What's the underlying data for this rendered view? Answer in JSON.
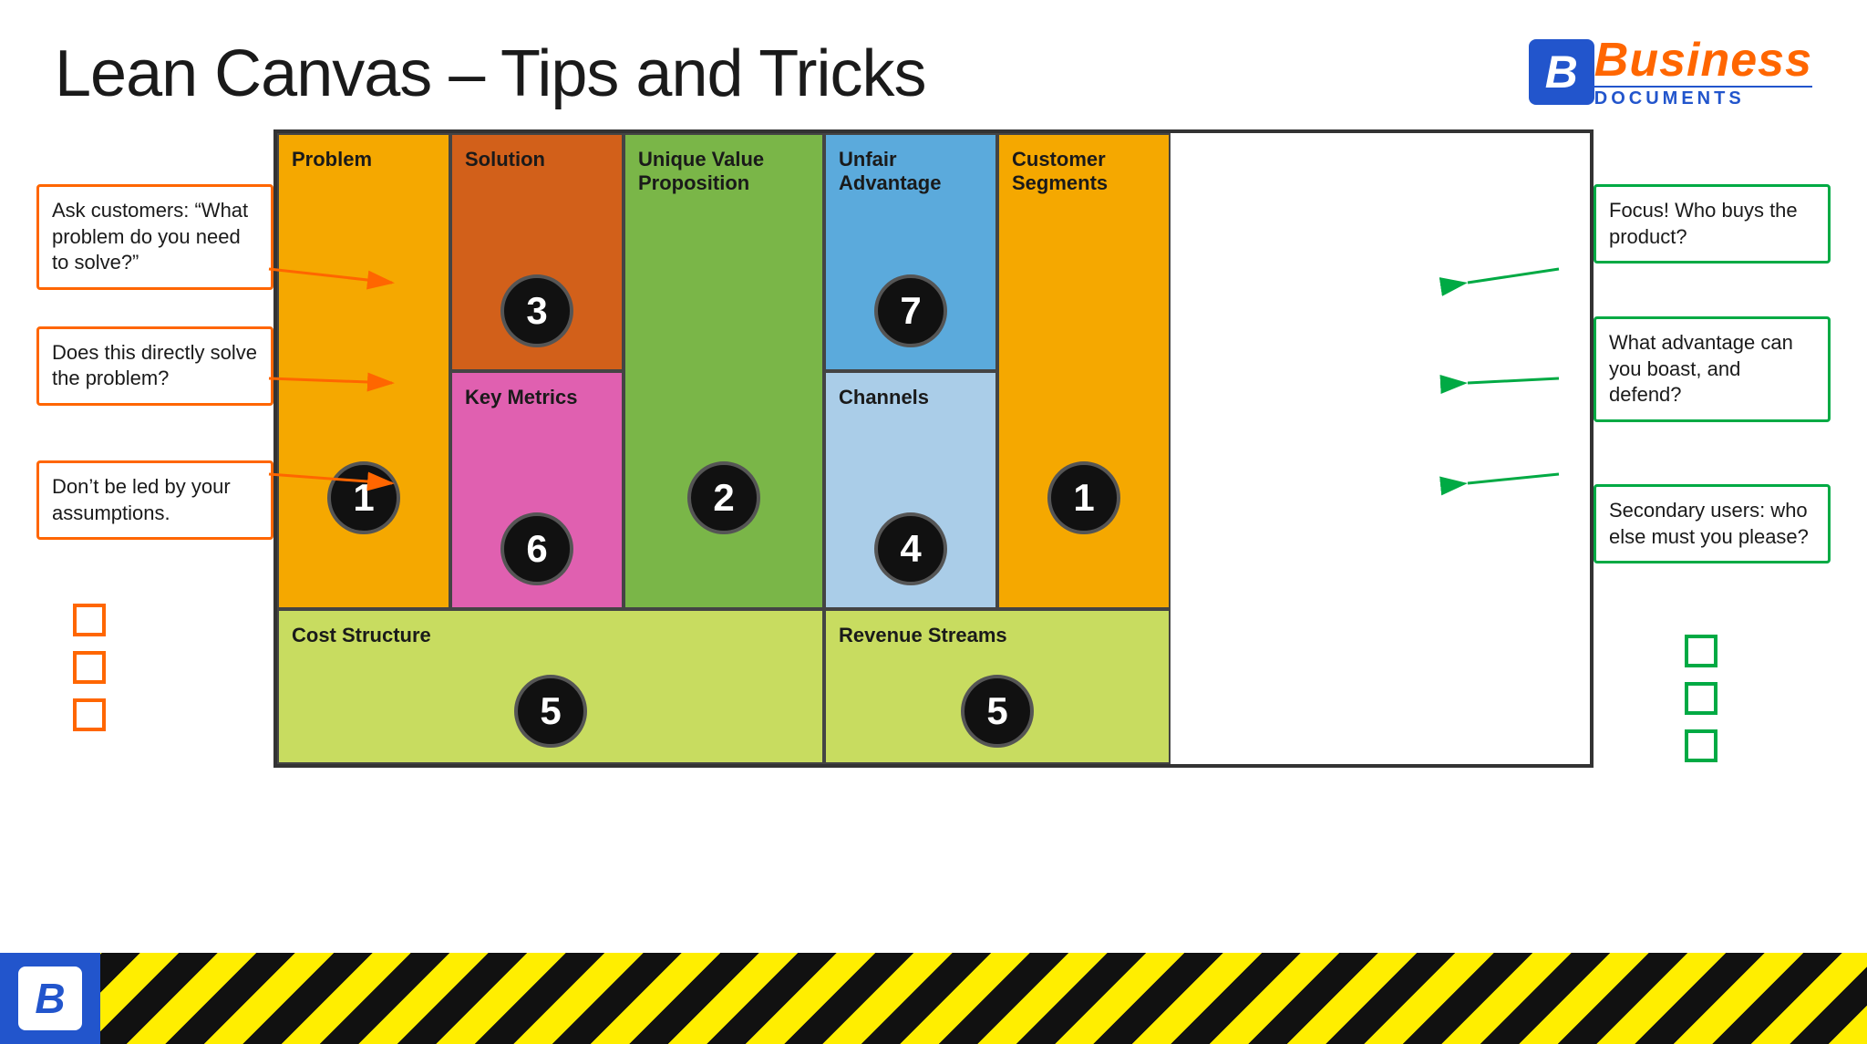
{
  "header": {
    "title": "Lean Canvas – Tips and Tricks",
    "logo": {
      "b_letter": "B",
      "business": "Business",
      "documents": "DOCUMENTS"
    }
  },
  "canvas": {
    "cells": [
      {
        "id": "problem",
        "label": "Problem",
        "number": "1",
        "color": "#f5a800"
      },
      {
        "id": "solution",
        "label": "Solution",
        "number": "3",
        "color": "#d2601a"
      },
      {
        "id": "uvp",
        "label": "Unique Value Proposition",
        "number": "2",
        "color": "#7ab648"
      },
      {
        "id": "unfair",
        "label": "Unfair Advantage",
        "number": "7",
        "color": "#5baadc"
      },
      {
        "id": "customer",
        "label": "Customer Segments",
        "number": "1",
        "color": "#f5a800"
      },
      {
        "id": "keymetrics",
        "label": "Key Metrics",
        "number": "6",
        "color": "#e060b0"
      },
      {
        "id": "channels",
        "label": "Channels",
        "number": "4",
        "color": "#aacde8"
      },
      {
        "id": "cost",
        "label": "Cost Structure",
        "number": "5",
        "color": "#c8dc60"
      },
      {
        "id": "revenue",
        "label": "Revenue Streams",
        "number": "5",
        "color": "#c8dc60"
      }
    ]
  },
  "left_annotations": [
    {
      "id": "ann-left-1",
      "text": "Ask customers: “What problem do you need to solve?”"
    },
    {
      "id": "ann-left-2",
      "text": "Does this directly solve the problem?"
    },
    {
      "id": "ann-left-3",
      "text": "Don’t be led by your assumptions."
    }
  ],
  "right_annotations": [
    {
      "id": "ann-right-1",
      "text": "Focus! Who buys the product?"
    },
    {
      "id": "ann-right-2",
      "text": "What advantage can you boast, and defend?"
    },
    {
      "id": "ann-right-3",
      "text": "Secondary users: who else must you please?"
    }
  ],
  "checkboxes": {
    "left_count": 3,
    "right_count": 3
  },
  "footer": {
    "b_letter": "B"
  }
}
